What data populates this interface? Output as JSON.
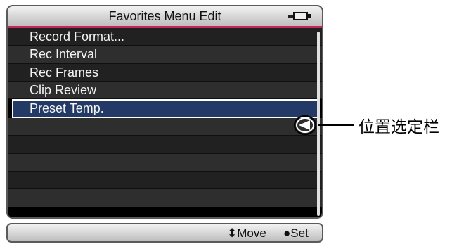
{
  "menu": {
    "title": "Favorites Menu Edit",
    "items": [
      {
        "label": "Record Format..."
      },
      {
        "label": "Rec Interval"
      },
      {
        "label": "Rec Frames"
      },
      {
        "label": "Clip Review"
      },
      {
        "label": "Preset Temp.",
        "selected": true
      },
      {
        "label": ""
      },
      {
        "label": ""
      },
      {
        "label": ""
      },
      {
        "label": ""
      },
      {
        "label": ""
      }
    ]
  },
  "footer": {
    "move_label": "Move",
    "set_label": "Set"
  },
  "callout": {
    "label": "位置选定栏"
  },
  "icons": {
    "battery": "battery-icon",
    "move": "up-down-arrow-icon",
    "set": "dot-icon",
    "position_marker": "left-arrow-marker-icon"
  },
  "colors": {
    "title_accent": "#c2285a",
    "selection_background": "#233a66",
    "screen_background": "#000000"
  }
}
